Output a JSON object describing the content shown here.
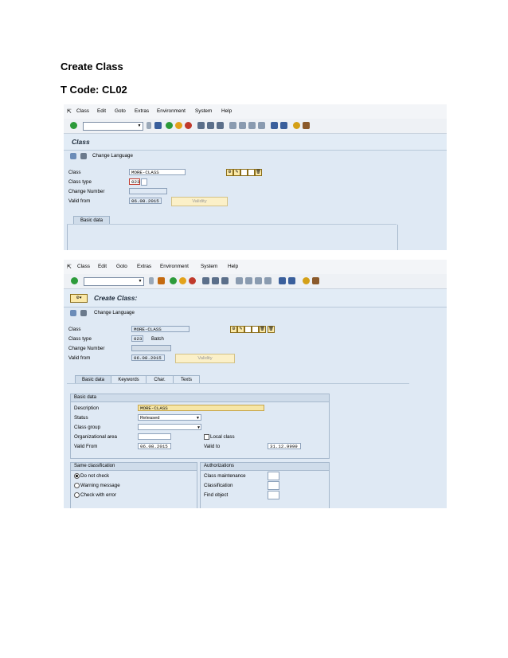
{
  "doc": {
    "heading": "Create Class",
    "tcode": "T Code: CL02"
  },
  "menu": [
    "Class",
    "Edit",
    "Goto",
    "Extras",
    "Environment",
    "System",
    "Help"
  ],
  "screen1": {
    "title": "Class",
    "change_language": "Change Language",
    "fields": {
      "class_label": "Class",
      "class_value": "MORE-CLASS",
      "class_type_label": "Class type",
      "class_type_value": "023",
      "change_number_label": "Change Number",
      "valid_from_label": "Valid from",
      "valid_from_value": "06.08.2015",
      "validity_button": "Validity"
    },
    "tab": "Basic data"
  },
  "screen2": {
    "title": "Create Class:",
    "change_language": "Change Language",
    "fields": {
      "class_label": "Class",
      "class_value": "MORE-CLASS",
      "class_type_label": "Class type",
      "class_type_value": "023",
      "class_type_text": "Batch",
      "change_number_label": "Change Number",
      "valid_from_label": "Valid from",
      "valid_from_value": "06.08.2015",
      "validity_button": "Validity"
    },
    "tabs": [
      "Basic data",
      "Keywords",
      "Char.",
      "Texts"
    ],
    "basic_data": {
      "title": "Basic data",
      "description_label": "Description",
      "description_value": "MORE-CLASS",
      "status_label": "Status",
      "status_value": "Released",
      "class_group_label": "Class group",
      "org_area_label": "Organizational area",
      "local_class_label": "Local class",
      "valid_from_label": "Valid From",
      "valid_from_value": "06.08.2015",
      "valid_to_label": "Valid to",
      "valid_to_value": "31.12.9999"
    },
    "same_classification": {
      "title": "Same classification",
      "options": [
        "Do not check",
        "Warning message",
        "Check with error"
      ],
      "selected": 0
    },
    "authorizations": {
      "title": "Authorizations",
      "items": [
        "Class maintenance",
        "Classification",
        "Find object"
      ]
    }
  }
}
